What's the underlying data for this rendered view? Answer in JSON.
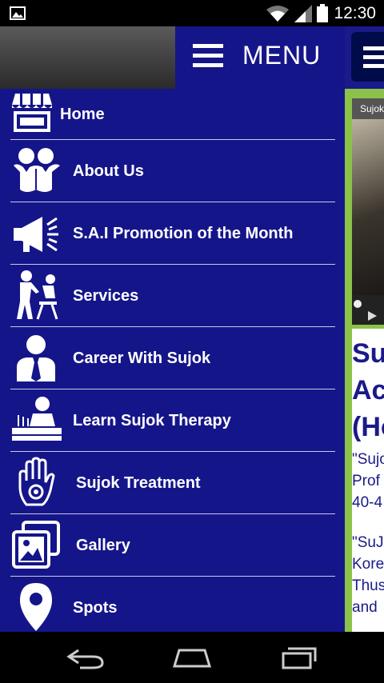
{
  "status_bar": {
    "time": "12:30"
  },
  "drawer": {
    "menu_title": "MENU",
    "items": [
      {
        "label": "Home",
        "icon": "storefront-icon"
      },
      {
        "label": "About Us",
        "icon": "people-hug-icon"
      },
      {
        "label": "S.A.I Promotion of the Month",
        "icon": "megaphone-icon"
      },
      {
        "label": "Services",
        "icon": "massage-chair-icon"
      },
      {
        "label": "Career With Sujok",
        "icon": "businessman-icon"
      },
      {
        "label": "Learn Sujok Therapy",
        "icon": "acupuncture-patient-icon"
      },
      {
        "label": "Sujok Treatment",
        "icon": "hand-icon"
      },
      {
        "label": "Gallery",
        "icon": "picture-gallery-icon"
      },
      {
        "label": "Spots",
        "icon": "location-pin-icon"
      }
    ]
  },
  "background_page": {
    "video_title": "Sujok",
    "heading_lines": [
      "Su",
      "Ac",
      "(Ho"
    ],
    "para1_lines": [
      "\"Sujok",
      "Prof",
      "40-4"
    ],
    "para2_lines": [
      "\"SuJ",
      "Kore",
      "Thus",
      "and"
    ]
  },
  "colors": {
    "drawer_bg": "#15158a",
    "accent_green": "#8bc34a",
    "divider": "#c9c9e6"
  }
}
